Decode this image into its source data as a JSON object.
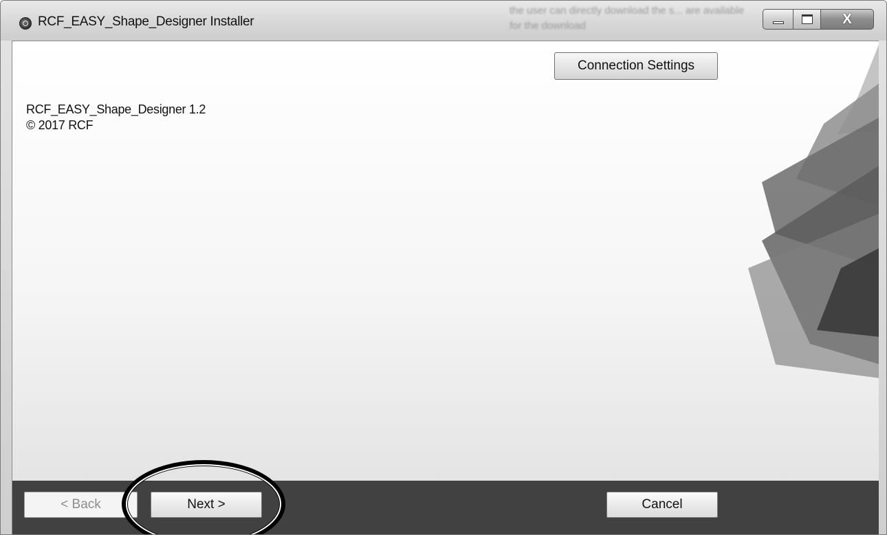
{
  "window": {
    "title": "RCF_EASY_Shape_Designer Installer",
    "background_text": "the user can directly download the s... are available for the download",
    "close_glyph": "X"
  },
  "main": {
    "connection_settings_label": "Connection Settings",
    "product_name": "RCF_EASY_Shape_Designer 1.2",
    "copyright": "© 2017 RCF"
  },
  "footer": {
    "back_label": "< Back",
    "next_label": "Next >",
    "cancel_label": "Cancel"
  },
  "icons": {
    "app": "app-logo-icon",
    "minimize": "minimize-icon",
    "maximize": "maximize-icon",
    "close": "close-icon"
  },
  "colors": {
    "footer_bg": "#414141",
    "highlight_ring": "#000000"
  }
}
